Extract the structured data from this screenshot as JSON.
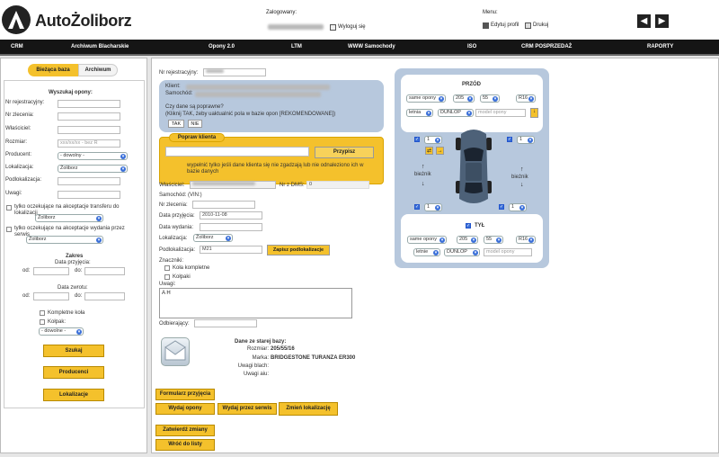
{
  "app": {
    "title": "AutoŻoliborz"
  },
  "header": {
    "logged_in_label": "Zalogowany:",
    "logout_label": "Wyloguj się",
    "menu_label": "Menu:",
    "edit_profile_label": "Edytuj profil",
    "print_label": "Drukuj"
  },
  "nav": {
    "items": [
      "CRM",
      "Archiwum Blacharskie",
      "Opony 2.0",
      "LTM",
      "WWW Samochody",
      "ISO",
      "CRM POSPRZEDAŻ",
      "RAPORTY"
    ]
  },
  "sidebar": {
    "tab_current": "Bieżąca baza",
    "tab_archive": "Archiwum",
    "search_title": "Wyszukaj opony:",
    "reg_label": "Nr rejestracyjny:",
    "order_label": "Nr zlecenia:",
    "owner_label": "Właściciel:",
    "size_label": "Rozmiar:",
    "size_placeholder": "xxx/xx/xx - bez R",
    "producer_label": "Producent:",
    "producer_value": "- dowolny -",
    "location_label": "Lokalizacja:",
    "location_value": "Żoliborz",
    "sublocation_label": "Podlokalizacja:",
    "notes_label": "Uwagi:",
    "transfer_label": "tylko oczekujące na akceptacje transferu do lokalizacji",
    "transfer_value": "Żoliborz",
    "release_label": "tylko oczekujące na akceptacje wydania przez serwis",
    "release_value": "Żoliborz",
    "range_title": "Zakres",
    "intake_date_label": "Data przyjęcia:",
    "return_date_label": "Data zwrotu:",
    "from_label": "od:",
    "to_label": "do:",
    "complete_wheels_label": "Kompletne koła",
    "hubcap_label": "Kołpak:",
    "hubcap_value": "- dowolne -",
    "search_button": "Szukaj",
    "producers_button": "Producenci",
    "locations_button": "Lokalizacje"
  },
  "form": {
    "reg_label": "Nr rejestracyjny:",
    "client_label": "Klient:",
    "car_label": "Samochód:",
    "question": "Czy dane są poprawne?",
    "question_hint": "(Kliknij TAK, żeby uaktualnić pola w bazie opon [REKOMENDOWANE])",
    "yes": "TAK",
    "no": "NIE",
    "fix_client_title": "Popraw klienta",
    "assign_button": "Przypisz",
    "assign_hint": "wypełnić tylko jeśli dane klienta się nie zgadzają lub nie odnaleziono ich w bazie danych",
    "owner_label": "Właściciel:",
    "dms_label": "Nr z DMS:",
    "dms_value": "0",
    "car_vin_label": "Samochód: (VIN:)",
    "order_label": "Nr zlecenia:",
    "intake_label": "Data przyjęcia:",
    "intake_value": "2010-11-08",
    "release_label": "Data wydania:",
    "location_label": "Lokalizacja:",
    "location_value": "Żoliborz",
    "sublocation_label": "Podlokalizacja:",
    "sublocation_value": "M21",
    "save_sublocation_button": "Zapisz podlokalizacje",
    "marks_label": "Znaczniki:",
    "complete_wheels_label": "Koła kompletne",
    "hubcaps_label": "Kołpaki",
    "notes_label": "Uwagi:",
    "notes_value": "A H",
    "recipient_label": "Odbierający:",
    "old_data_title": "Dane ze starej bazy:",
    "old_size_label": "Rozmiar:",
    "old_size_value": "205/55/16",
    "old_brand_label": "Marka:",
    "old_brand_value": "BRIDGESTONE TURANZA ER300",
    "old_body_label": "Uwagi blach:",
    "old_notes_label": "Uwagi aiu:",
    "intake_form_button": "Formularz przyjęcia",
    "release_tires_button": "Wydaj opony",
    "release_service_button": "Wydaj przez serwis",
    "change_location_button": "Zmień lokalizację",
    "confirm_button": "Zatwierdź zmiany",
    "back_button": "Wróć do listy"
  },
  "tires": {
    "front_title": "PRZÓD",
    "rear_title": "TYŁ",
    "front": {
      "type": "same opony",
      "width": "205",
      "profile": "55",
      "rim": "R16",
      "season": "letnia",
      "brand": "DUNLOP",
      "model_placeholder": "model opony"
    },
    "rear": {
      "type": "same opony",
      "width": "205",
      "profile": "55",
      "rim": "R16",
      "season": "letnie",
      "brand": "DUNLOP",
      "model_placeholder": "model opony"
    },
    "tread_label": "bieżnik",
    "fl": "1",
    "fr": "1",
    "fl2": "1",
    "fr2": "1",
    "rl": "1",
    "rr": "1"
  }
}
